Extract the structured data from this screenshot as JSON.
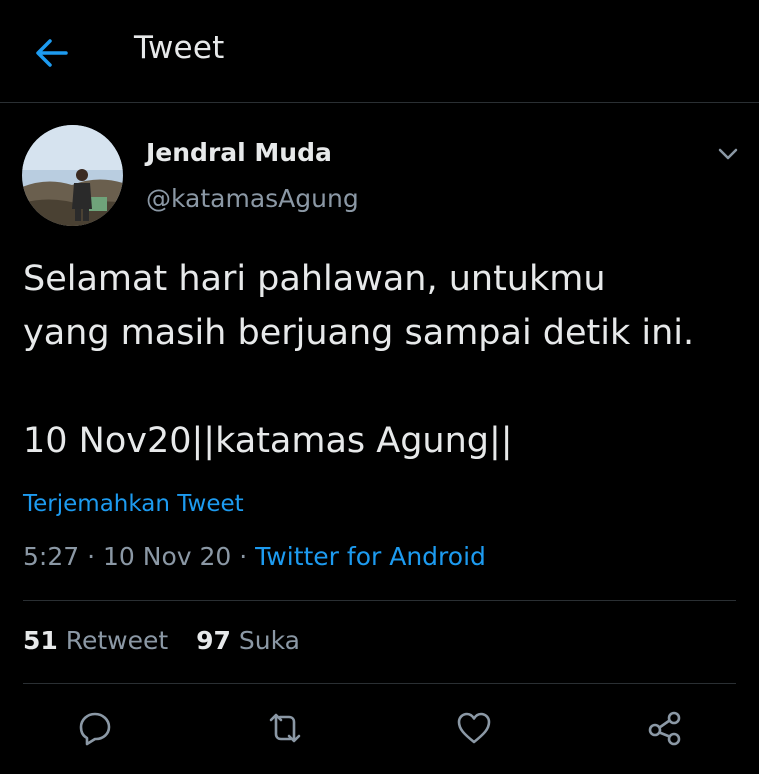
{
  "header": {
    "title": "Tweet",
    "back_icon": "arrow-left-icon"
  },
  "author": {
    "display_name": "Jendral Muda",
    "handle": "@katamasAgung",
    "more_icon": "chevron-down-icon"
  },
  "tweet": {
    "text": "Selamat hari pahlawan, untukmu\nyang masih berjuang sampai detik ini.\n\n10 Nov20||katamas Agung||",
    "translate_label": "Terjemahkan Tweet",
    "time": "5:27",
    "date": "10 Nov 20",
    "separator": "·",
    "source": "Twitter for Android"
  },
  "stats": {
    "retweets": {
      "count": "51",
      "label": "Retweet"
    },
    "likes": {
      "count": "97",
      "label": "Suka"
    }
  },
  "actions": [
    "reply-icon",
    "retweet-icon",
    "like-icon",
    "share-icon"
  ],
  "colors": {
    "background": "#000000",
    "accent": "#1d9bf0",
    "muted": "#8b98a5",
    "text": "#e7e9ea"
  }
}
